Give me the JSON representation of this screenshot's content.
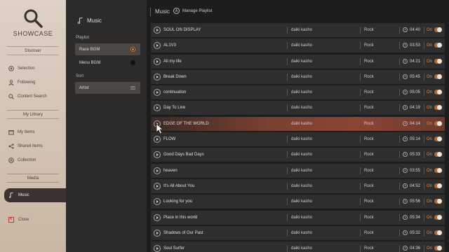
{
  "app": {
    "brand": "SHOWCASE",
    "icon": "search-icon"
  },
  "nav": {
    "sections": {
      "discover": "Discover",
      "library": "My Library",
      "media": "Media"
    },
    "items": {
      "selection": "Selection",
      "following": "Following",
      "content_search": "Content Search",
      "my_items": "My Items",
      "shared_items": "Shared Items",
      "collection": "Collection",
      "music": "Music",
      "close": "Close"
    }
  },
  "mid": {
    "title": "Music",
    "playlist_label": "Playlist",
    "playlists": [
      {
        "label": "Race BGM",
        "selected": true
      },
      {
        "label": "Menu BGM",
        "selected": false
      }
    ],
    "sort_label": "Sort",
    "sort_value": "Artist"
  },
  "main": {
    "breadcrumb": "Music",
    "manage_button": "Manage Playlist",
    "accent": "#e08a3c",
    "on_label": "On",
    "tracks": [
      {
        "title": "SOUL ON DISPLAY",
        "artist": "daiki kasho",
        "genre": "Rock",
        "duration": "04:40"
      },
      {
        "title": "AL1V3",
        "artist": "daiki kasho",
        "genre": "Rock",
        "duration": "03:53"
      },
      {
        "title": "All my life",
        "artist": "daiki kasho",
        "genre": "Rock",
        "duration": "04:21"
      },
      {
        "title": "Break Down",
        "artist": "daiki kasho",
        "genre": "Rock",
        "duration": "05:45"
      },
      {
        "title": "continuation",
        "artist": "daiki kasho",
        "genre": "Rock",
        "duration": "05:05"
      },
      {
        "title": "Day To Live",
        "artist": "daiki kasho",
        "genre": "Rock",
        "duration": "04:19"
      },
      {
        "title": "EDGE OF THE WORLD",
        "artist": "daiki kasho",
        "genre": "Rock",
        "duration": "04:14",
        "highlighted": true
      },
      {
        "title": "FLOW",
        "artist": "daiki kasho",
        "genre": "Rock",
        "duration": "05:14"
      },
      {
        "title": "Good Days Bad Days",
        "artist": "daiki kasho",
        "genre": "Rock",
        "duration": "05:33"
      },
      {
        "title": "heaven",
        "artist": "daiki kasho",
        "genre": "Rock",
        "duration": "03:55"
      },
      {
        "title": "It's All About You",
        "artist": "daiki kasho",
        "genre": "Rock",
        "duration": "04:52"
      },
      {
        "title": "Looking for you",
        "artist": "daiki kasho",
        "genre": "Rock",
        "duration": "05:56"
      },
      {
        "title": "Place in this world",
        "artist": "daiki kasho",
        "genre": "Rock",
        "duration": "05:34"
      },
      {
        "title": "Shadows of Our Past",
        "artist": "daiki kasho",
        "genre": "Rock",
        "duration": "05:32"
      },
      {
        "title": "Soul Surfer",
        "artist": "daiki kasho",
        "genre": "Rock",
        "duration": "04:36"
      }
    ]
  }
}
